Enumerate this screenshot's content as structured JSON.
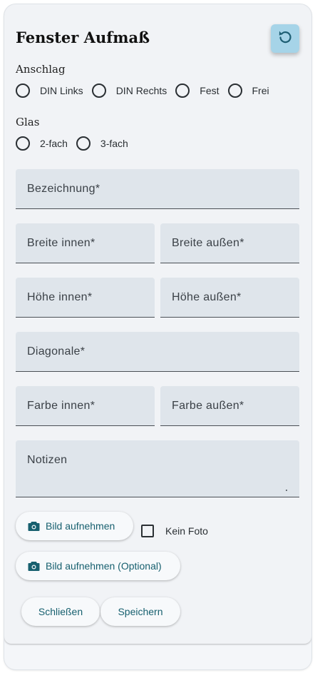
{
  "dialog": {
    "title": "Fenster Aufmaß",
    "reset_icon": "refresh-icon"
  },
  "anschlag": {
    "label": "Anschlag",
    "options": [
      "DIN Links",
      "DIN Rechts",
      "Fest",
      "Frei"
    ]
  },
  "glas": {
    "label": "Glas",
    "options": [
      "2-fach",
      "3-fach"
    ]
  },
  "fields": {
    "bezeichnung": "Bezeichnung*",
    "breite_innen": "Breite innen*",
    "breite_aussen": "Breite außen*",
    "hoehe_innen": "Höhe innen*",
    "hoehe_aussen": "Höhe außen*",
    "diagonale": "Diagonale*",
    "farbe_innen": "Farbe innen*",
    "farbe_aussen": "Farbe außen*",
    "notizen": "Notizen"
  },
  "photo": {
    "take_photo": "Bild aufnehmen",
    "take_photo_optional": "Bild aufnehmen (Optional)",
    "no_photo": "Kein Foto",
    "camera_icon": "camera-icon"
  },
  "actions": {
    "close": "Schließen",
    "save": "Speichern"
  },
  "colors": {
    "accent": "#17606f",
    "reset_button": "#a6d4e8",
    "field_bg": "#dfe5eb",
    "card_bg": "#f1f3f6"
  }
}
